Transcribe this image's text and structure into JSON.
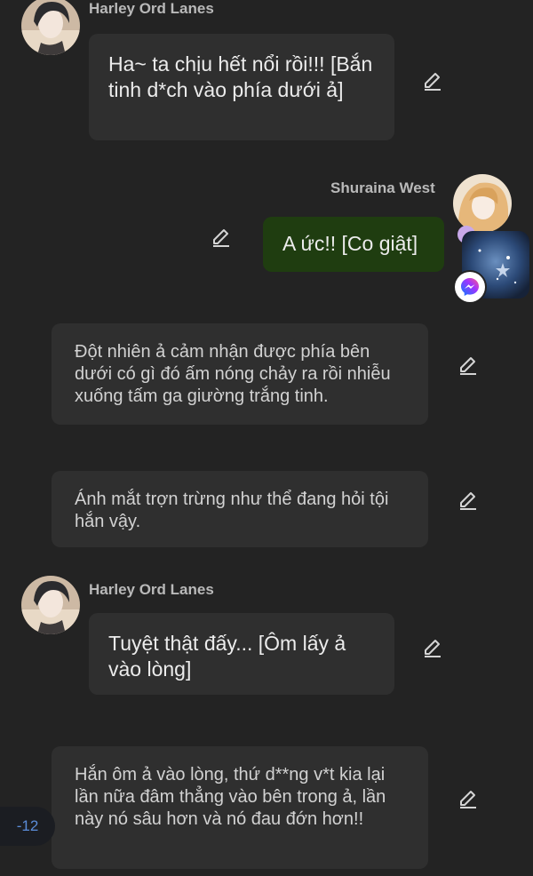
{
  "messages": [
    {
      "sender": "Harley Ord Lanes",
      "text": "Ha~ ta chịu hết nổi rồi!!! [Bắn tinh d*ch vào phía dưới ả]"
    },
    {
      "sender": "Shuraina West",
      "text": "A ức!! [Co giật]"
    },
    {
      "text": "Đột nhiên ả cảm nhận được phía bên dưới có gì đó ấm nóng chảy ra rồi nhiễu xuống tấm ga giường trắng tinh."
    },
    {
      "text": "Ánh mắt trợn trừng như thể đang hỏi tội hắn vậy."
    },
    {
      "sender": "Harley Ord Lanes",
      "text": "Tuyệt thật đấy... [Ôm lấy ả vào lòng]"
    },
    {
      "text": "Hắn ôm ả vào lòng, thứ d**ng v*t kia lại lần nữa đâm thẳng vào bên trong ả, lần này nó sâu hơn và nó đau đớn hơn!!"
    }
  ],
  "unread_badge": "-12",
  "icons": {
    "edit": "pencil-icon",
    "messenger": "messenger-icon"
  },
  "colors": {
    "background": "#232323",
    "bubble": "#2f2f2f",
    "sent_bubble": "#1f3d10",
    "status_dot": "#c8a8ea",
    "badge_text": "#5b8cd8"
  }
}
